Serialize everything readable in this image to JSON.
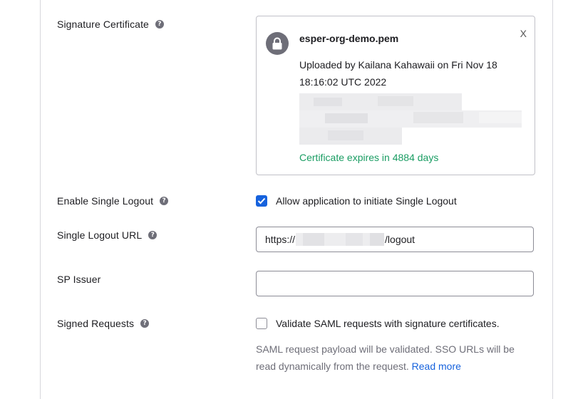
{
  "fields": {
    "signature_certificate": {
      "label": "Signature Certificate"
    },
    "enable_single_logout": {
      "label": "Enable Single Logout"
    },
    "single_logout_url": {
      "label": "Single Logout URL"
    },
    "sp_issuer": {
      "label": "SP Issuer"
    },
    "signed_requests": {
      "label": "Signed Requests"
    }
  },
  "help_icon": "?",
  "certificate": {
    "filename": "esper-org-demo.pem",
    "close_label": "X",
    "uploaded_text": "Uploaded by Kailana Kahawaii on Fri Nov 18 18:16:02 UTC 2022",
    "expires_text": "Certificate expires in 4884 days",
    "expires_color": "#1a9d63"
  },
  "single_logout": {
    "checkbox_checked": true,
    "checkbox_label": "Allow application to initiate Single Logout",
    "url_prefix": "https://",
    "url_suffix": "/logout"
  },
  "sp_issuer_value": "",
  "signed_requests": {
    "checkbox_checked": false,
    "checkbox_label": "Validate SAML requests with signature certificates.",
    "hint_text": "SAML request payload will be validated. SSO URLs will be read dynamically from the request.",
    "read_more_label": "Read more"
  },
  "colors": {
    "accent": "#1662dd",
    "success": "#1a9d63",
    "muted_text": "#6e6e78"
  }
}
